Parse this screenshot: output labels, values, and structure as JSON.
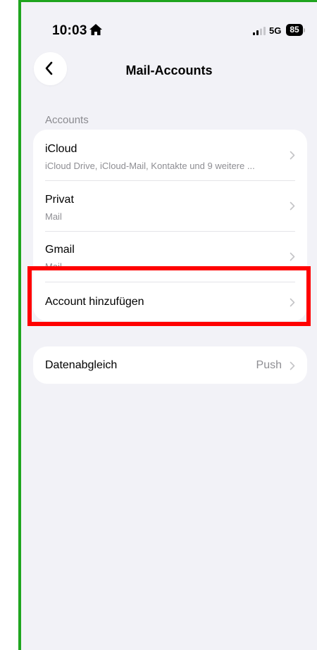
{
  "status_bar": {
    "time": "10:03",
    "network": "5G",
    "battery": "85",
    "icons": [
      "home-icon",
      "signal-icon"
    ]
  },
  "nav": {
    "title": "Mail-Accounts",
    "back_icon": "chevron-left-icon"
  },
  "accounts_section": {
    "header": "Accounts",
    "items": [
      {
        "title": "iCloud",
        "subtitle": "iCloud Drive, iCloud-Mail, Kontakte und 9 weitere ..."
      },
      {
        "title": "Privat",
        "subtitle": "Mail"
      },
      {
        "title": "Gmail",
        "subtitle": "Mail"
      }
    ],
    "add_account_label": "Account hinzufügen"
  },
  "sync_section": {
    "label": "Datenabgleich",
    "value": "Push"
  },
  "colors": {
    "background": "#f2f2f7",
    "card": "#ffffff",
    "secondary_text": "#8e8e93",
    "highlight": "#ff0000",
    "frame": "#1fa51f"
  }
}
